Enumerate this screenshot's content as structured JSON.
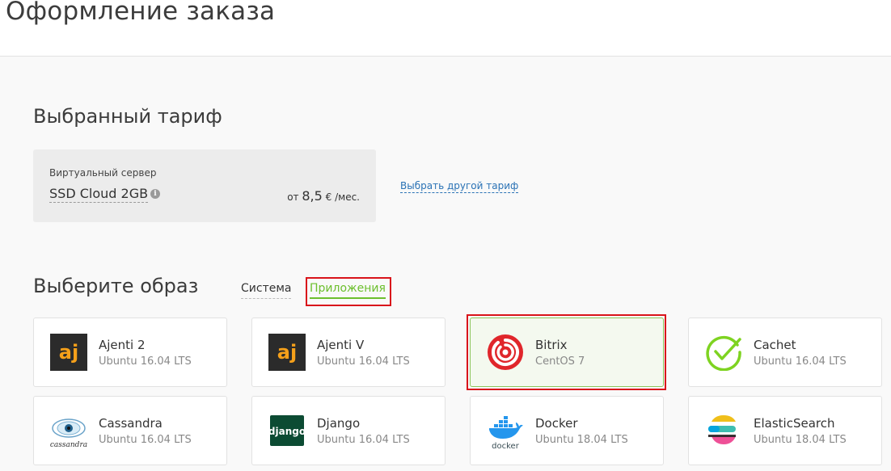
{
  "page": {
    "title": "Оформление заказа"
  },
  "tariff": {
    "section_title": "Выбранный тариф",
    "kind": "Виртуальный сервер",
    "name": "SSD Cloud 2GB",
    "price_prefix": "от",
    "price_amount": "8,5",
    "price_unit": "€ /мес.",
    "change_link": "Выбрать другой тариф"
  },
  "images": {
    "section_title": "Выберите образ",
    "tabs": [
      {
        "label": "Система",
        "active": false
      },
      {
        "label": "Приложения",
        "active": true
      }
    ],
    "cards": [
      {
        "name": "Ajenti 2",
        "os": "Ubuntu 16.04 LTS",
        "icon": "ajenti-icon",
        "selected": false
      },
      {
        "name": "Ajenti V",
        "os": "Ubuntu 16.04 LTS",
        "icon": "ajenti-icon",
        "selected": false
      },
      {
        "name": "Bitrix",
        "os": "CentOS 7",
        "icon": "bitrix-icon",
        "selected": true
      },
      {
        "name": "Cachet",
        "os": "Ubuntu 16.04 LTS",
        "icon": "cachet-icon",
        "selected": false
      },
      {
        "name": "Cassandra",
        "os": "Ubuntu 16.04 LTS",
        "icon": "cassandra-icon",
        "selected": false
      },
      {
        "name": "Django",
        "os": "Ubuntu 16.04 LTS",
        "icon": "django-icon",
        "selected": false
      },
      {
        "name": "Docker",
        "os": "Ubuntu 18.04 LTS",
        "icon": "docker-icon",
        "selected": false
      },
      {
        "name": "ElasticSearch",
        "os": "Ubuntu 18.04 LTS",
        "icon": "elasticsearch-icon",
        "selected": false
      }
    ],
    "logo_text": {
      "ajenti": "aj",
      "cassandra": "cassandra",
      "django": "django",
      "docker": "docker"
    }
  },
  "colors": {
    "accent_green": "#6cbf2d",
    "highlight_red": "#d9141b",
    "link_blue": "#2a72b5",
    "bitrix_red": "#e0262b"
  }
}
